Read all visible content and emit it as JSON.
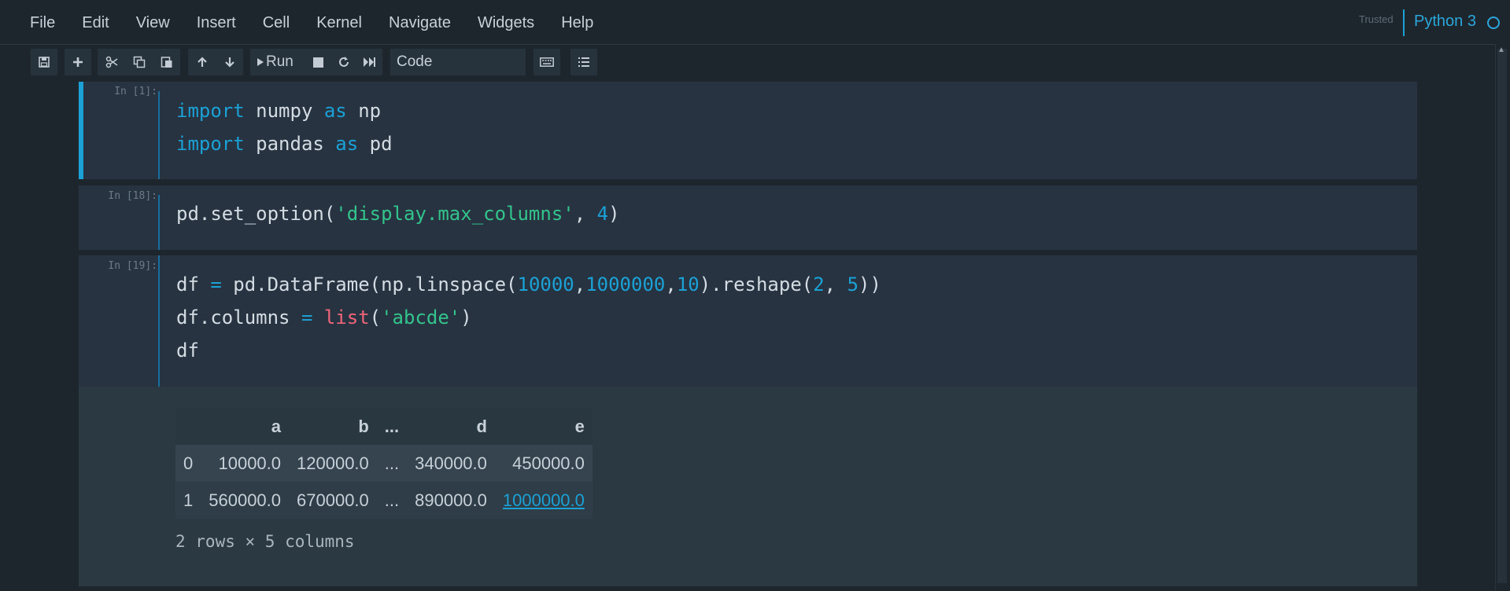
{
  "menu": [
    "File",
    "Edit",
    "View",
    "Insert",
    "Cell",
    "Kernel",
    "Navigate",
    "Widgets",
    "Help"
  ],
  "status": {
    "trusted": "Trusted",
    "kernel": "Python 3"
  },
  "toolbar": {
    "run_label": "Run",
    "cell_type": "Code",
    "icons": [
      "save-icon",
      "plus-icon",
      "scissors-icon",
      "copy-icon",
      "paste-icon",
      "arrow-up-icon",
      "arrow-down-icon",
      "run-icon",
      "stop-icon",
      "restart-icon",
      "fast-forward-icon",
      "keyboard-icon",
      "list-icon"
    ]
  },
  "cells": [
    {
      "prompt": "In [1]:",
      "lines": [
        "import numpy as np",
        "import pandas as pd"
      ]
    },
    {
      "prompt": "In [18]:",
      "lines": [
        "pd.set_option('display.max_columns', 4)"
      ]
    },
    {
      "prompt": "In [19]:",
      "lines": [
        "df = pd.DataFrame(np.linspace(10000,1000000,10).reshape(2, 5))",
        "df.columns = list('abcde')",
        "df"
      ]
    }
  ],
  "output": {
    "columns": [
      "",
      "a",
      "b",
      "...",
      "d",
      "e"
    ],
    "rows": [
      [
        "0",
        "10000.0",
        "120000.0",
        "...",
        "340000.0",
        "450000.0"
      ],
      [
        "1",
        "560000.0",
        "670000.0",
        "...",
        "890000.0",
        "1000000.0"
      ]
    ],
    "summary": "2 rows × 5 columns"
  }
}
